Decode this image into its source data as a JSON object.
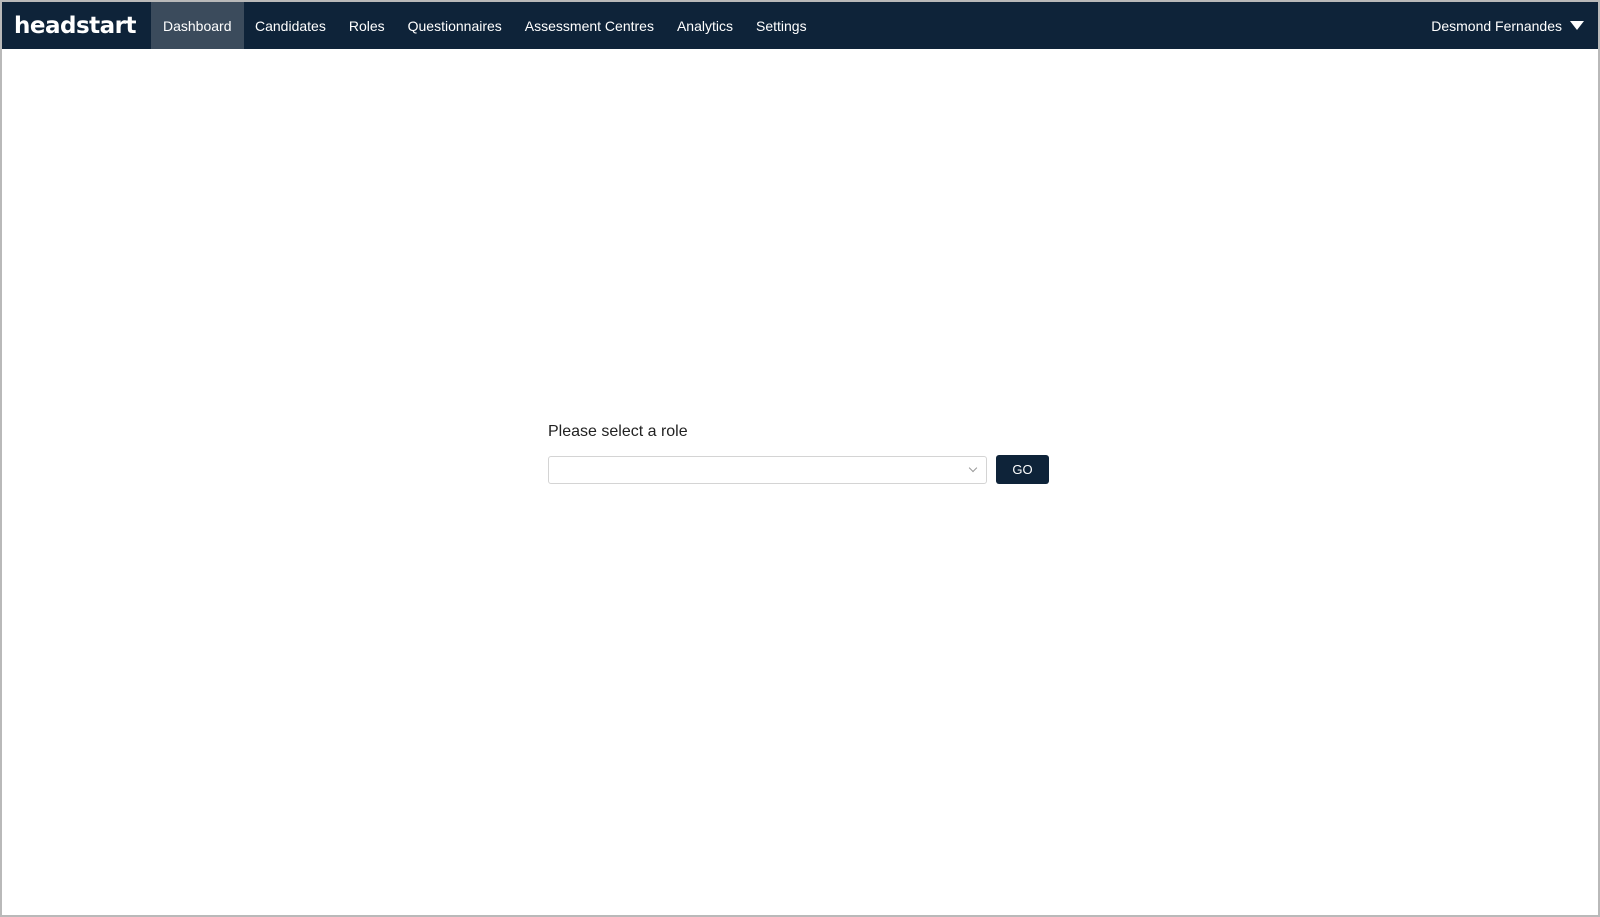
{
  "brand": {
    "name": "headstart"
  },
  "nav": {
    "items": [
      {
        "label": "Dashboard",
        "active": true
      },
      {
        "label": "Candidates",
        "active": false
      },
      {
        "label": "Roles",
        "active": false
      },
      {
        "label": "Questionnaires",
        "active": false
      },
      {
        "label": "Assessment Centres",
        "active": false
      },
      {
        "label": "Analytics",
        "active": false
      },
      {
        "label": "Settings",
        "active": false
      }
    ]
  },
  "user": {
    "name": "Desmond Fernandes",
    "icon": "caret-down-icon"
  },
  "role_selector": {
    "label": "Please select a role",
    "selected_value": "",
    "button_label": "GO"
  },
  "colors": {
    "navbar_bg": "#0e2339",
    "active_tab_bg": "#3b4b5c",
    "button_bg": "#0e2339",
    "text": "#222222"
  }
}
